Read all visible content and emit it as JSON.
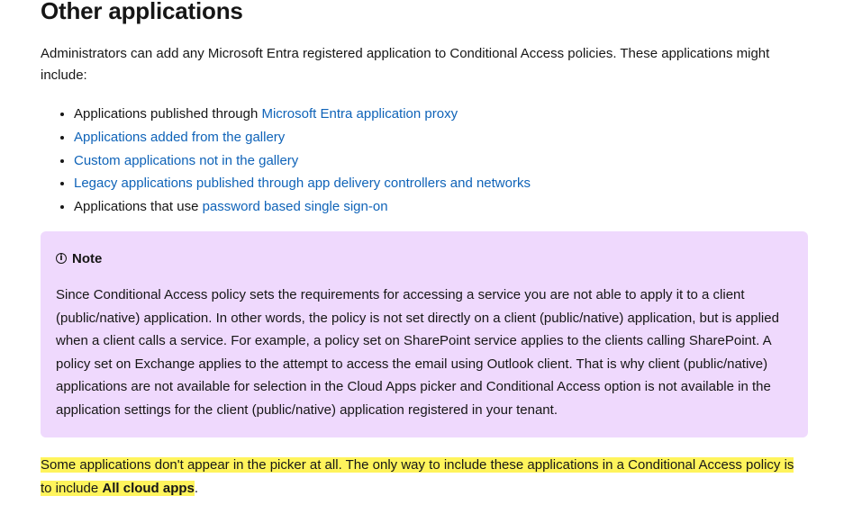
{
  "section": {
    "title": "Other applications",
    "intro": "Administrators can add any Microsoft Entra registered application to Conditional Access policies. These applications might include:"
  },
  "apps_list": [
    {
      "prefix": "Applications published through ",
      "link": "Microsoft Entra application proxy"
    },
    {
      "prefix": "",
      "link": "Applications added from the gallery"
    },
    {
      "prefix": "",
      "link": "Custom applications not in the gallery"
    },
    {
      "prefix": "",
      "link": "Legacy applications published through app delivery controllers and networks"
    },
    {
      "prefix": "Applications that use ",
      "link": "password based single sign-on"
    }
  ],
  "note": {
    "icon": "info-circle-icon",
    "label": "Note",
    "body": "Since Conditional Access policy sets the requirements for accessing a service you are not able to apply it to a client (public/native) application. In other words, the policy is not set directly on a client (public/native) application, but is applied when a client calls a service. For example, a policy set on SharePoint service applies to the clients calling SharePoint. A policy set on Exchange applies to the attempt to access the email using Outlook client. That is why client (public/native) applications are not available for selection in the Cloud Apps picker and Conditional Access option is not available in the application settings for the client (public/native) application registered in your tenant."
  },
  "final_paragraph": {
    "text_before": "Some applications don't appear in the picker at all. The only way to include these applications in a Conditional Access policy is to include ",
    "bold": "All cloud apps",
    "text_after": "."
  },
  "colors": {
    "link": "#0f63b8",
    "note_background": "#efd9fd",
    "highlight": "#fff45c",
    "text": "#161616"
  }
}
